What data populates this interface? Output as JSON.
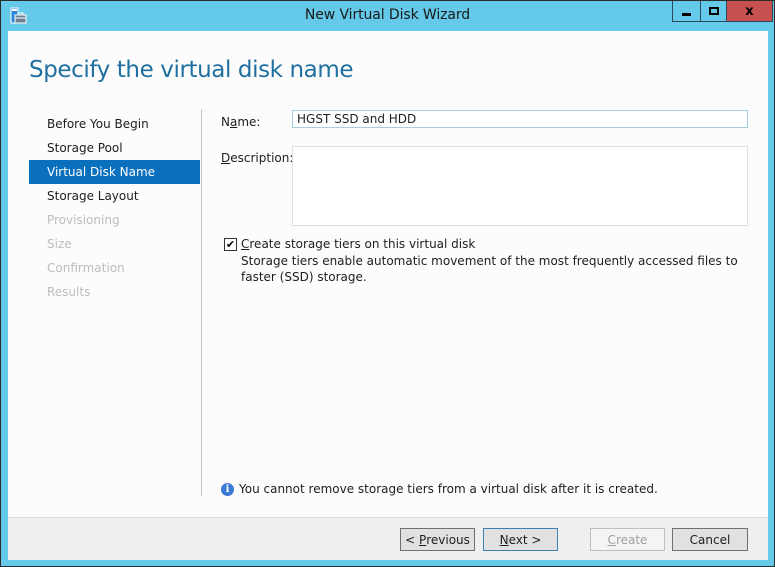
{
  "window": {
    "title": "New Virtual Disk Wizard",
    "icon": "server-manager-toolbox-icon",
    "controls": {
      "minimize": "minimize-icon",
      "maximize": "maximize-icon",
      "close_glyph": "x"
    }
  },
  "page": {
    "title": "Specify the virtual disk name"
  },
  "nav": {
    "items": [
      {
        "label": "Before You Begin",
        "state": "enabled"
      },
      {
        "label": "Storage Pool",
        "state": "enabled"
      },
      {
        "label": "Virtual Disk Name",
        "state": "selected"
      },
      {
        "label": "Storage Layout",
        "state": "enabled"
      },
      {
        "label": "Provisioning",
        "state": "disabled"
      },
      {
        "label": "Size",
        "state": "disabled"
      },
      {
        "label": "Confirmation",
        "state": "disabled"
      },
      {
        "label": "Results",
        "state": "disabled"
      }
    ]
  },
  "form": {
    "name_label_pre": "N",
    "name_label_accel": "a",
    "name_label_post": "me:",
    "name_value": "HGST SSD and HDD",
    "description_label_accel": "D",
    "description_label_post": "escription:",
    "description_value": "",
    "tiers_checkbox": {
      "checked": true,
      "check_glyph": "✔",
      "label_accel": "C",
      "label_post": "reate storage tiers on this virtual disk",
      "help_text": "Storage tiers enable automatic movement of the most frequently accessed files to faster (SSD) storage."
    }
  },
  "info": {
    "icon_glyph": "i",
    "text": "You cannot remove storage tiers from a virtual disk after it is created."
  },
  "footer": {
    "previous_pre": "< ",
    "previous_accel": "P",
    "previous_post": "revious",
    "next_accel": "N",
    "next_post": "ext >",
    "create_accel": "C",
    "create_post": "reate",
    "cancel_label": "Cancel"
  },
  "colors": {
    "frame": "#65c9ea",
    "accent_selected": "#0a6fbd",
    "title_text": "#1f6fa0",
    "close_button": "#c75050",
    "info_icon": "#3a79d4"
  }
}
